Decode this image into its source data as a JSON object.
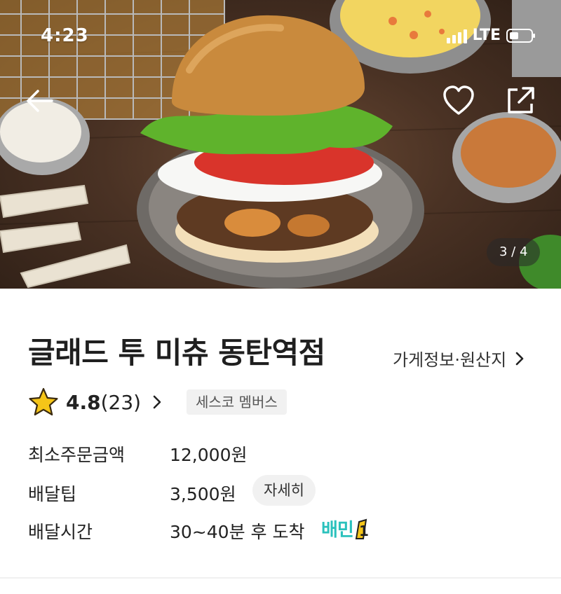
{
  "status_bar": {
    "time": "4:23",
    "network": "LTE"
  },
  "hero": {
    "page_indicator": "3 / 4",
    "icons": {
      "back": "back-arrow-icon",
      "favorite": "heart-icon",
      "share": "share-icon"
    }
  },
  "store": {
    "name": "글래드 투 미츄 동탄역점",
    "info_link": "가게정보·원산지",
    "rating": "4.8",
    "review_count": "(23)",
    "member_badge": "세스코 멤버스"
  },
  "details": {
    "min_order_label": "최소주문금액",
    "min_order_value": "12,000원",
    "delivery_tip_label": "배달팁",
    "delivery_tip_value": "3,500원",
    "delivery_tip_detail": "자세히",
    "delivery_time_label": "배달시간",
    "delivery_time_value": "30~40분 후 도착",
    "baemin_badge": "배민",
    "baemin_badge_number": "1"
  },
  "colors": {
    "baemin_mint": "#2ac1bc",
    "star": "#f5c518",
    "badge_bg": "#f1f1f1"
  }
}
